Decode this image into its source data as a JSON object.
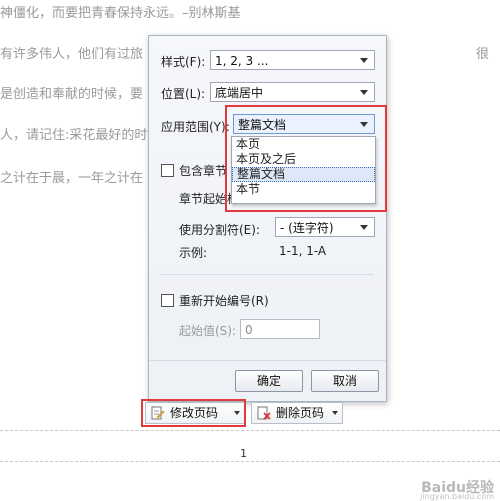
{
  "document": {
    "lines": [
      "神僵化，而要把青春保持永远。–别林斯基",
      "有许多伟人，他们有过旅",
      "是创造和奉献的时候，要",
      "人，请记住:采花最好的时",
      "之计在于晨，一年之计在"
    ],
    "right_fragment": "很",
    "page_number": "1"
  },
  "dialog": {
    "style_label": "样式(F):",
    "style_value": "1, 2, 3 ...",
    "position_label": "位置(L):",
    "position_value": "底端居中",
    "apply_label": "应用范围(Y):",
    "apply_value": "整篇文档",
    "apply_options": [
      "本页",
      "本页及之后",
      "整篇文档",
      "本节"
    ],
    "apply_selected_index": 2,
    "include_chapter_label": "包含章节",
    "chapter_start_label": "章节起始样",
    "separator_label": "使用分割符(E):",
    "separator_value": "-    (连字符)",
    "example_label": "示例:",
    "example_value": "1-1, 1-A",
    "restart_label": "重新开始编号(R)",
    "start_value_label": "起始值(S):",
    "start_value": "0",
    "ok_label": "确定",
    "cancel_label": "取消"
  },
  "toolbar": {
    "modify_label": "修改页码",
    "delete_label": "删除页码"
  },
  "watermark": {
    "text": "Baidu经验",
    "sub": "jingyan.baidu.com"
  },
  "colors": {
    "highlight": "#e03a3a",
    "dropdown_selected_bg": "#dde8f8",
    "dialog_border": "#a9b3c2"
  }
}
